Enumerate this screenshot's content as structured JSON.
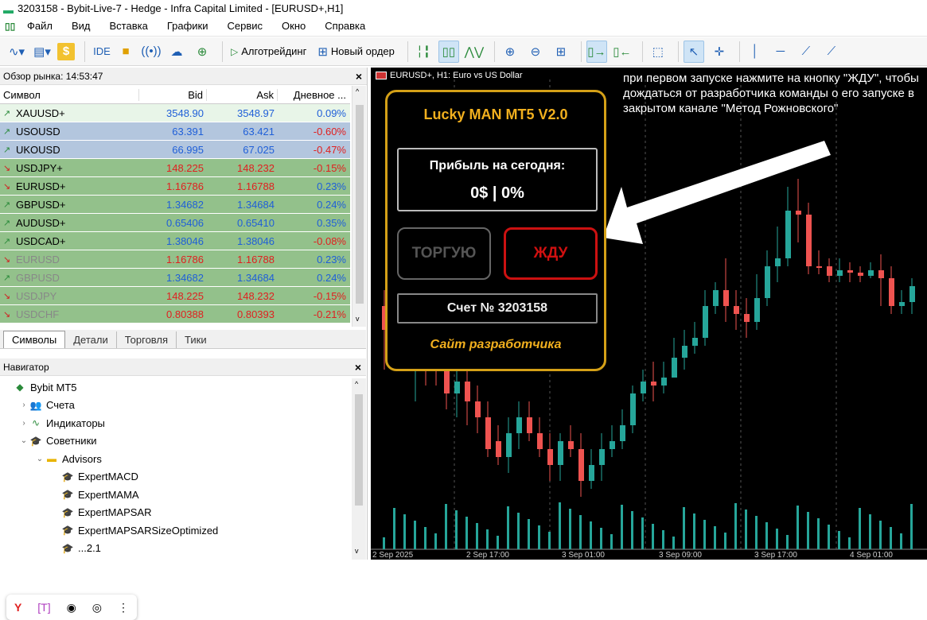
{
  "window": {
    "title": "3203158 - Bybit-Live-7 - Hedge - Infra Capital Limited - [EURUSD+,H1]"
  },
  "menu": {
    "items": [
      "Файл",
      "Вид",
      "Вставка",
      "Графики",
      "Сервис",
      "Окно",
      "Справка"
    ]
  },
  "toolbar": {
    "ide_label": "IDE",
    "algo_label": "Алготрейдинг",
    "neworder_label": "Новый ордер"
  },
  "market_watch": {
    "title": "Обзор рынка: 14:53:47",
    "columns": {
      "symbol": "Символ",
      "bid": "Bid",
      "ask": "Ask",
      "change": "Дневное ..."
    },
    "rows": [
      {
        "arrow": "up",
        "symbol": "XAUUSD+",
        "bid": "3548.90",
        "ask": "3548.97",
        "change": "0.09%",
        "bg": "#e8f5e8",
        "bidcolor": "#1f5fd8",
        "chgcolor": "#1f5fd8"
      },
      {
        "arrow": "up",
        "symbol": "USOUSD",
        "bid": "63.391",
        "ask": "63.421",
        "change": "-0.60%",
        "bg": "#b3c6de",
        "bidcolor": "#1f5fd8",
        "chgcolor": "#e02020"
      },
      {
        "arrow": "up",
        "symbol": "UKOUSD",
        "bid": "66.995",
        "ask": "67.025",
        "change": "-0.47%",
        "bg": "#b3c6de",
        "bidcolor": "#1f5fd8",
        "chgcolor": "#e02020"
      },
      {
        "arrow": "down",
        "symbol": "USDJPY+",
        "bid": "148.225",
        "ask": "148.232",
        "change": "-0.15%",
        "bg": "#93c18b",
        "bidcolor": "#e02020",
        "chgcolor": "#e02020"
      },
      {
        "arrow": "down",
        "symbol": "EURUSD+",
        "bid": "1.16786",
        "ask": "1.16788",
        "change": "0.23%",
        "bg": "#93c18b",
        "bidcolor": "#e02020",
        "chgcolor": "#1f5fd8"
      },
      {
        "arrow": "up",
        "symbol": "GBPUSD+",
        "bid": "1.34682",
        "ask": "1.34684",
        "change": "0.24%",
        "bg": "#93c18b",
        "bidcolor": "#1f5fd8",
        "chgcolor": "#1f5fd8"
      },
      {
        "arrow": "up",
        "symbol": "AUDUSD+",
        "bid": "0.65406",
        "ask": "0.65410",
        "change": "0.35%",
        "bg": "#93c18b",
        "bidcolor": "#1f5fd8",
        "chgcolor": "#1f5fd8"
      },
      {
        "arrow": "up",
        "symbol": "USDCAD+",
        "bid": "1.38046",
        "ask": "1.38046",
        "change": "-0.08%",
        "bg": "#93c18b",
        "bidcolor": "#1f5fd8",
        "chgcolor": "#e02020"
      },
      {
        "arrow": "down",
        "symbol": "EURUSD",
        "bid": "1.16786",
        "ask": "1.16788",
        "change": "0.23%",
        "bg": "#93c18b",
        "bidcolor": "#e02020",
        "chgcolor": "#1f5fd8",
        "dim": true
      },
      {
        "arrow": "up",
        "symbol": "GBPUSD",
        "bid": "1.34682",
        "ask": "1.34684",
        "change": "0.24%",
        "bg": "#93c18b",
        "bidcolor": "#1f5fd8",
        "chgcolor": "#1f5fd8",
        "dim": true
      },
      {
        "arrow": "down",
        "symbol": "USDJPY",
        "bid": "148.225",
        "ask": "148.232",
        "change": "-0.15%",
        "bg": "#93c18b",
        "bidcolor": "#e02020",
        "chgcolor": "#e02020",
        "dim": true
      },
      {
        "arrow": "down",
        "symbol": "USDCHF",
        "bid": "0.80388",
        "ask": "0.80393",
        "change": "-0.21%",
        "bg": "#93c18b",
        "bidcolor": "#e02020",
        "chgcolor": "#e02020",
        "dim": true
      }
    ],
    "tabs": [
      "Символы",
      "Детали",
      "Торговля",
      "Тики"
    ]
  },
  "navigator": {
    "title": "Навигатор",
    "items": [
      {
        "label": "Bybit MT5",
        "indent": 0,
        "exp": "",
        "icon": "broker-icon"
      },
      {
        "label": "Счета",
        "indent": 1,
        "exp": ">",
        "icon": "accounts-icon"
      },
      {
        "label": "Индикаторы",
        "indent": 1,
        "exp": ">",
        "icon": "indicators-icon"
      },
      {
        "label": "Советники",
        "indent": 1,
        "exp": "v",
        "icon": "advisors-icon"
      },
      {
        "label": "Advisors",
        "indent": 2,
        "exp": "v",
        "icon": "folder-icon"
      },
      {
        "label": "ExpertMACD",
        "indent": 3,
        "exp": "",
        "icon": "expert-icon"
      },
      {
        "label": "ExpertMAMA",
        "indent": 3,
        "exp": "",
        "icon": "expert-icon"
      },
      {
        "label": "ExpertMAPSAR",
        "indent": 3,
        "exp": "",
        "icon": "expert-icon"
      },
      {
        "label": "ExpertMAPSARSizeOptimized",
        "indent": 3,
        "exp": "",
        "icon": "expert-icon"
      },
      {
        "label": "...2.1",
        "indent": 3,
        "exp": "",
        "icon": "expert-icon"
      }
    ]
  },
  "chart": {
    "label": "EURUSD+, H1:  Euro vs US Dollar",
    "annotation": "при первом запуске нажмите на кнопку \"ЖДУ\", чтобы дождаться от разработчика команды о его запуске в закрытом канале \"Метод Рожновского\"",
    "xlabels": [
      "2 Sep 2025",
      "2 Sep 17:00",
      "3 Sep 01:00",
      "3 Sep 09:00",
      "3 Sep 17:00",
      "4 Sep 01:00"
    ],
    "panel": {
      "title": "Lucky MAN MT5 V2.0",
      "profit_label": "Прибыль на сегодня:",
      "profit_value": "0$  |  0%",
      "btn_trade": "ТОРГУЮ",
      "btn_wait": "ЖДУ",
      "account": "Счет № 3203158",
      "dev_link": "Сайт разработчика"
    },
    "colors": {
      "bull": "#26a69a",
      "bear": "#ef5350",
      "volume": "#26a69a",
      "panel_border": "#d4a017"
    }
  }
}
